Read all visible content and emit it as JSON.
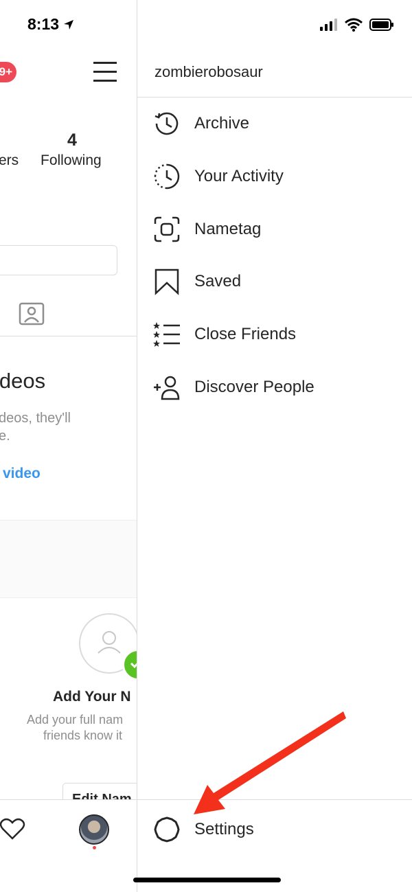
{
  "status_bar": {
    "time": "8:13"
  },
  "profile_bg": {
    "notif_badge": "9+",
    "following_count": "4",
    "followers_label_cut": "ers",
    "following_label": "Following",
    "videos_title": "ideos",
    "videos_sub_line1": "deos, they'll",
    "videos_sub_line2": "e.",
    "videos_link": "video",
    "add_name_title": "Add Your N",
    "add_name_sub1": "Add your full nam",
    "add_name_sub2": "friends know it",
    "edit_name_button": "Edit Nam"
  },
  "drawer": {
    "username": "zombierobosaur",
    "items": [
      {
        "label": "Archive",
        "icon": "archive-icon"
      },
      {
        "label": "Your Activity",
        "icon": "activity-icon"
      },
      {
        "label": "Nametag",
        "icon": "nametag-icon"
      },
      {
        "label": "Saved",
        "icon": "bookmark-icon"
      },
      {
        "label": "Close Friends",
        "icon": "close-friends-icon"
      },
      {
        "label": "Discover People",
        "icon": "add-person-icon"
      }
    ],
    "settings_label": "Settings"
  },
  "colors": {
    "badge": "#ed4956",
    "link": "#3897f0",
    "arrow": "#f2301b",
    "check": "#58c322"
  }
}
